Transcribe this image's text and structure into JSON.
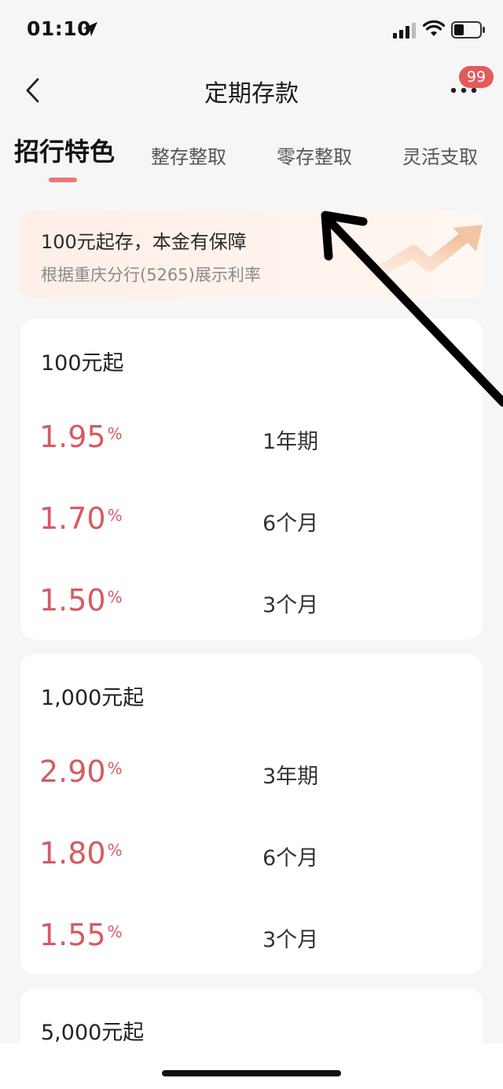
{
  "status_bar": {
    "time": "01:10"
  },
  "nav": {
    "title": "定期存款",
    "badge": "99"
  },
  "tabs": [
    {
      "label": "招行特色"
    },
    {
      "label": "整存整取"
    },
    {
      "label": "零存整取"
    },
    {
      "label": "灵活支取"
    }
  ],
  "banner": {
    "title": "100元起存，本金有保障",
    "subtitle": "根据重庆分行(5265)展示利率"
  },
  "cards": [
    {
      "title": "100元起",
      "rows": [
        {
          "rate": "1.95",
          "unit": "%",
          "term": "1年期"
        },
        {
          "rate": "1.70",
          "unit": "%",
          "term": "6个月"
        },
        {
          "rate": "1.50",
          "unit": "%",
          "term": "3个月"
        }
      ]
    },
    {
      "title": "1,000元起",
      "rows": [
        {
          "rate": "2.90",
          "unit": "%",
          "term": "3年期"
        },
        {
          "rate": "1.80",
          "unit": "%",
          "term": "6个月"
        },
        {
          "rate": "1.55",
          "unit": "%",
          "term": "3个月"
        }
      ]
    },
    {
      "title": "5,000元起",
      "rows": []
    }
  ],
  "colors": {
    "accent": "#d65b61",
    "badge": "#e25b5b",
    "indicator": "#e87878"
  }
}
